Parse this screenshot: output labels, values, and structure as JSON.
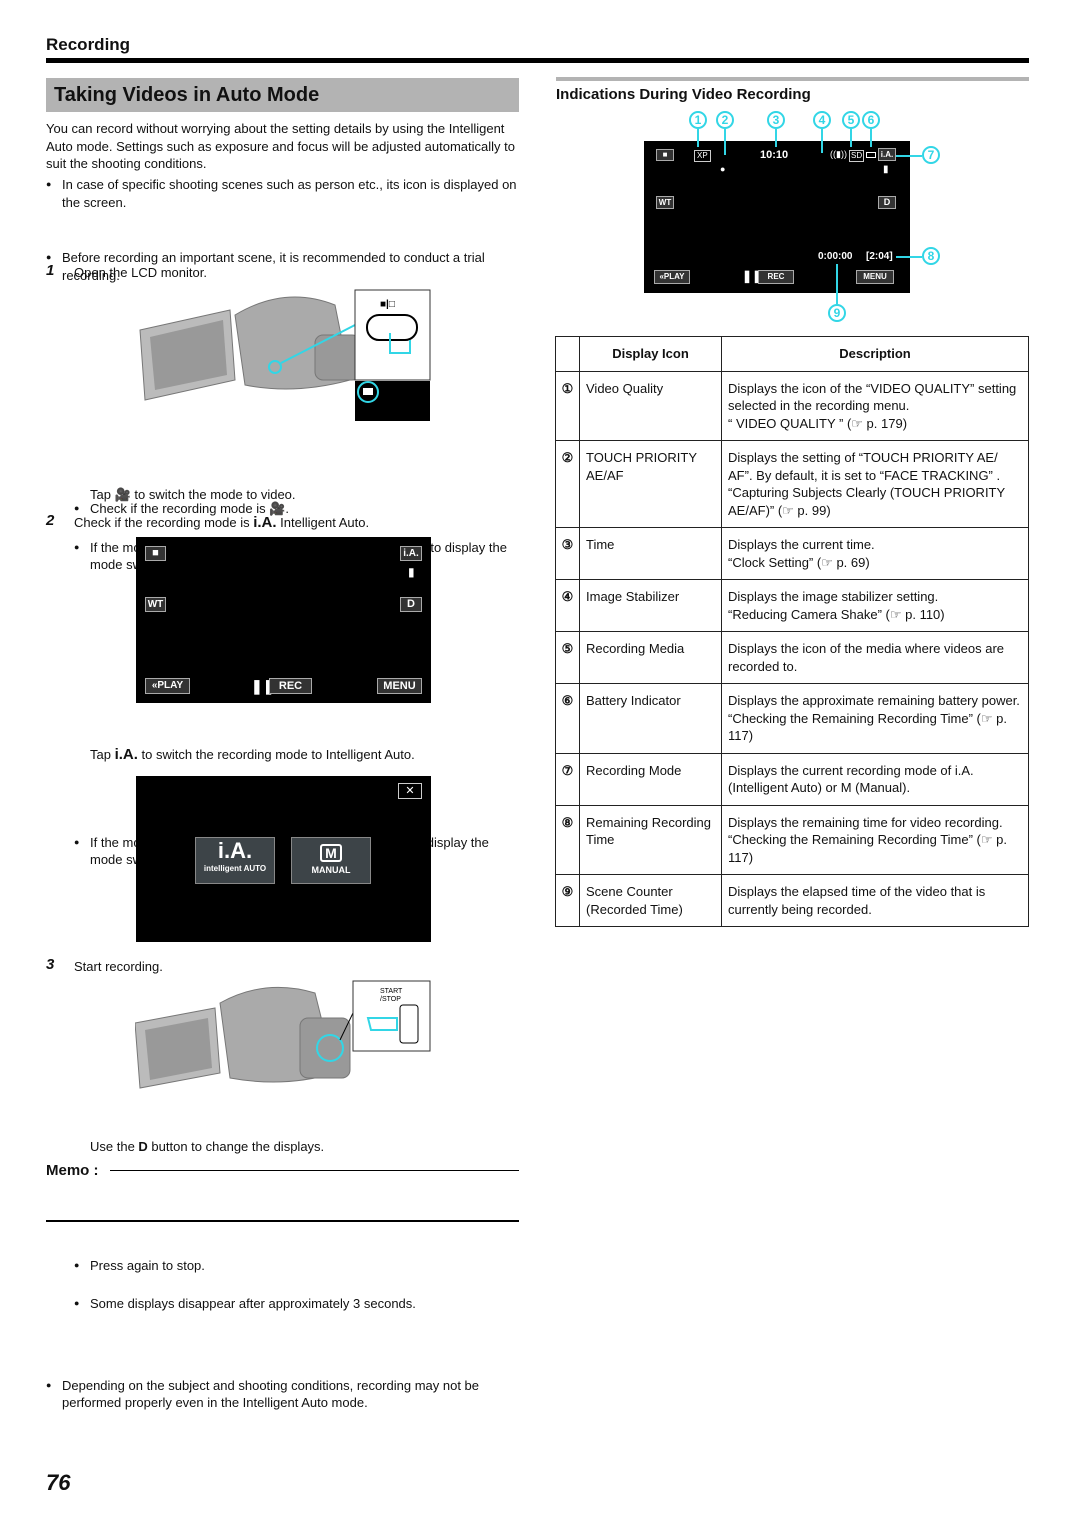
{
  "header": {
    "section": "Recording",
    "title": "Taking Videos in Auto Mode"
  },
  "intro": {
    "paragraph": "You can record without worrying about the setting details by using the Intelligent Auto mode. Settings such as exposure and focus will be adjusted automatically to suit the shooting conditions.",
    "bullets": [
      "In case of specific shooting scenes such as person etc., its icon is displayed on the screen.",
      "Before recording an important scene, it is recommended to conduct a trial recording."
    ]
  },
  "steps": [
    {
      "num": "1",
      "text": "Open the LCD monitor.",
      "bullets": [
        "Check if the recording mode is 🎥.",
        "If the mode is ▣ still image, tap ▣ on the recording screen to display the mode switching screen.",
        "Tap 🎥 to switch the mode to video."
      ],
      "illustration": {
        "mode_labels": "■|□"
      }
    },
    {
      "num": "2",
      "text_before": "Check if the recording mode is ",
      "ia_symbol": "i.A.",
      "text_after": " Intelligent Auto.",
      "screen": {
        "top_right": "i.A.",
        "wt": "WT",
        "d": "D",
        "play": "«PLAY",
        "rec": "REC",
        "menu": "MENU"
      },
      "bullets": [
        "If the mode is M Manual, tap M on the recording screen to display the mode switching screen."
      ],
      "tap_before": "Tap ",
      "tap_after": " to switch the recording mode to Intelligent Auto.",
      "mode_screen": {
        "ia_big": "i.A.",
        "ia_label": "intelligent AUTO",
        "m_big": "M",
        "m_label": "MANUAL",
        "close": "✕"
      }
    },
    {
      "num": "3",
      "text": "Start recording.",
      "illustration": {
        "button_label": "START /STOP"
      },
      "bullets": [
        "Press again to stop.",
        "Some displays disappear after approximately 3 seconds."
      ],
      "d_line_before": "Use the ",
      "d_symbol": "D",
      "d_line_after": " button to change the displays."
    }
  ],
  "memo": {
    "label": "Memo :",
    "bullets": [
      "Depending on the subject and shooting conditions, recording may not be performed properly even in the Intelligent Auto mode."
    ]
  },
  "indications": {
    "title": "Indications During Video Recording",
    "screen": {
      "quality": "XP",
      "time": "10:10",
      "media": "SD",
      "mode": "i.A.",
      "wt": "WT",
      "d": "D",
      "counter": "0:00:00",
      "remaining": "[2:04]",
      "play": "«PLAY",
      "rec": "REC",
      "menu": "MENU"
    },
    "callouts": [
      "1",
      "2",
      "3",
      "4",
      "5",
      "6",
      "7",
      "8",
      "9"
    ],
    "table": {
      "headers": [
        "",
        "Display Icon",
        "Description"
      ],
      "rows": [
        {
          "num": "①",
          "icon": "Video Quality",
          "desc": "Displays the icon of the “VIDEO QUALITY” setting selected in the recording menu.",
          "ref": "“ VIDEO QUALITY ” (☞ p. 179)"
        },
        {
          "num": "②",
          "icon": "TOUCH PRIORITY AE/AF",
          "desc": "Displays the setting of “TOUCH PRIORITY AE/ AF”. By default, it is set to “FACE TRACKING” .",
          "ref": "“Capturing Subjects Clearly (TOUCH PRIORITY AE/AF)” (☞ p. 99)"
        },
        {
          "num": "③",
          "icon": "Time",
          "desc": "Displays the current time.",
          "ref": "“Clock Setting” (☞ p. 69)"
        },
        {
          "num": "④",
          "icon": "Image Stabilizer",
          "desc": "Displays the image stabilizer setting.",
          "ref": "“Reducing Camera Shake” (☞ p. 110)"
        },
        {
          "num": "⑤",
          "icon": "Recording Media",
          "desc": "Displays the icon of the media where videos are recorded to.",
          "ref": ""
        },
        {
          "num": "⑥",
          "icon": "Battery Indicator",
          "desc": "Displays the approximate remaining battery power.",
          "ref": "“Checking the Remaining Recording Time” (☞ p. 117)"
        },
        {
          "num": "⑦",
          "icon": "Recording Mode",
          "desc": "Displays the current recording mode of i.A. (Intelligent Auto) or M (Manual).",
          "ref": ""
        },
        {
          "num": "⑧",
          "icon": "Remaining Recording Time",
          "desc": "Displays the remaining time for video recording.",
          "ref": "“Checking the Remaining Recording Time” (☞ p. 117)"
        },
        {
          "num": "⑨",
          "icon": "Scene Counter (Recorded Time)",
          "desc": "Displays the elapsed time of the video that is currently being recorded.",
          "ref": ""
        }
      ]
    }
  },
  "footer": {
    "page_number": "76"
  },
  "colors": {
    "callout": "#32d6e6",
    "title_bar": "#b3b3b3"
  }
}
